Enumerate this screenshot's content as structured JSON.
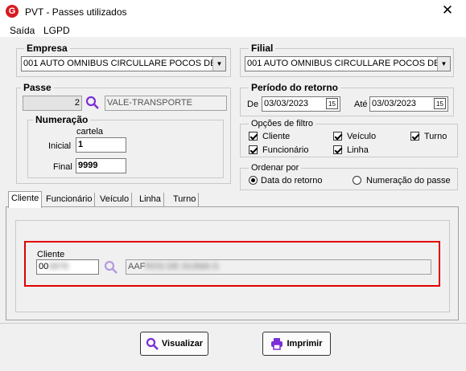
{
  "window": {
    "title": "PVT - Passes utilizados",
    "close": "✕",
    "app_icon_letter": "G"
  },
  "menu": {
    "items": [
      "Saída",
      "LGPD"
    ]
  },
  "empresa": {
    "label": "Empresa",
    "value": "001 AUTO OMNIBUS CIRCULLARE POCOS DE"
  },
  "filial": {
    "label": "Filial",
    "value": "001 AUTO OMNIBUS CIRCULLARE POCOS DE"
  },
  "passe": {
    "label": "Passe",
    "code": "2",
    "description": "VALE-TRANSPORTE"
  },
  "numeracao": {
    "label": "Numeração",
    "sub": "cartela",
    "inicial_label": "Inicial",
    "inicial_value": "1",
    "final_label": "Final",
    "final_value": "9999"
  },
  "periodo": {
    "label": "Período do retorno",
    "de_label": "De",
    "de_value": "03/03/2023",
    "ate_label": "Até",
    "ate_value": "03/03/2023",
    "cal_glyph": "15"
  },
  "opcoes": {
    "label": "Opções de filtro",
    "items": [
      "Cliente",
      "Veículo",
      "Turno",
      "Funcionário",
      "Linha"
    ]
  },
  "ordenar": {
    "label": "Ordenar por",
    "options": [
      "Data do retorno",
      "Numeração do passe"
    ],
    "selected": "Data do retorno"
  },
  "tabs": [
    "Cliente",
    "Funcionário",
    "Veículo",
    "Linha",
    "Turno"
  ],
  "cliente": {
    "label": "Cliente",
    "code": "00",
    "code_blur": "0878",
    "name": "AAF",
    "name_blur": "ROS DE GUIMA S"
  },
  "buttons": {
    "visualizar": "Visualizar",
    "imprimir": "Imprimir"
  },
  "colors": {
    "highlight": "#e00000",
    "accent_icon": "#7b2fd6",
    "brand": "#d71920"
  }
}
